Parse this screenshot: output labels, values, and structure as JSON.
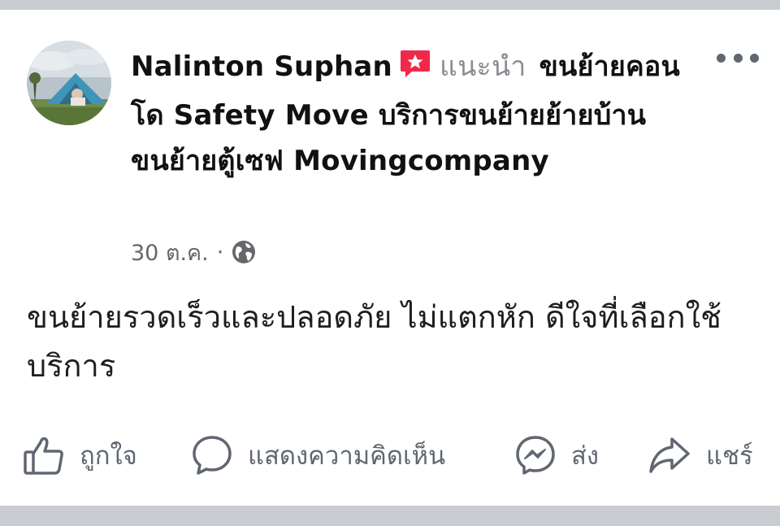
{
  "post": {
    "author": "Nalinton Suphan",
    "recommend_label": "แนะนำ",
    "page_name": "ขนย้ายคอนโด Safety Move บริการขนย้ายย้ายบ้าน ขนย้ายตู้เซฟ Movingcompany",
    "date": "30 ต.ค.",
    "separator": "·",
    "privacy_icon": "globe-icon",
    "text": "ขนย้ายรวดเร็วและปลอดภัย ไม่แตกหัก ดีใจที่เลือกใช้บริการ"
  },
  "actions": {
    "like": "ถูกใจ",
    "comment": "แสดงความคิดเห็น",
    "send": "ส่ง",
    "share": "แชร์"
  },
  "icons": {
    "recommend": "recommend-star-icon",
    "more": "more-options-icon",
    "like": "thumbs-up-icon",
    "comment": "comment-bubble-icon",
    "send": "messenger-icon",
    "share": "share-arrow-icon"
  },
  "colors": {
    "recommend_badge": "#f02849",
    "muted_text": "#65676b",
    "action_text": "#606770",
    "divider": "#c9ccd1"
  }
}
